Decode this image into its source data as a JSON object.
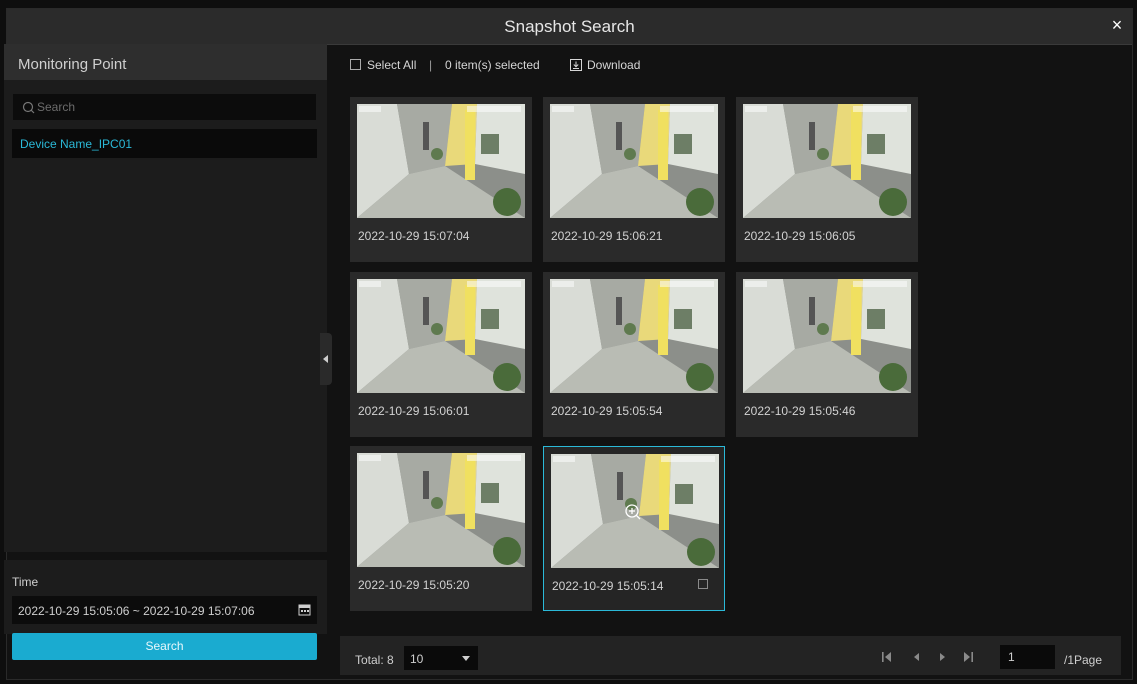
{
  "window": {
    "title": "Snapshot Search",
    "close_icon": "×"
  },
  "left": {
    "header": "Monitoring Point",
    "search_placeholder": "Search",
    "devices": [
      "Device Name_IPC01"
    ],
    "time_label": "Time",
    "time_range": "2022-10-29 15:05:06 ~ 2022-10-29 15:07:06",
    "search_button": "Search"
  },
  "toolbar": {
    "select_all": "Select All",
    "separator": "|",
    "selected_count": "0 item(s) selected",
    "download": "Download"
  },
  "snapshots": [
    {
      "timestamp": "2022-10-29 15:07:04"
    },
    {
      "timestamp": "2022-10-29 15:06:21"
    },
    {
      "timestamp": "2022-10-29 15:06:05"
    },
    {
      "timestamp": "2022-10-29 15:06:01"
    },
    {
      "timestamp": "2022-10-29 15:05:54"
    },
    {
      "timestamp": "2022-10-29 15:05:46"
    },
    {
      "timestamp": "2022-10-29 15:05:20"
    },
    {
      "timestamp": "2022-10-29 15:05:14"
    }
  ],
  "footer": {
    "total": "Total: 8",
    "page_size": "10",
    "current_page": "1",
    "page_suffix": "/1Page"
  },
  "colors": {
    "accent": "#1aabd0",
    "device_text": "#2bb9d8"
  }
}
